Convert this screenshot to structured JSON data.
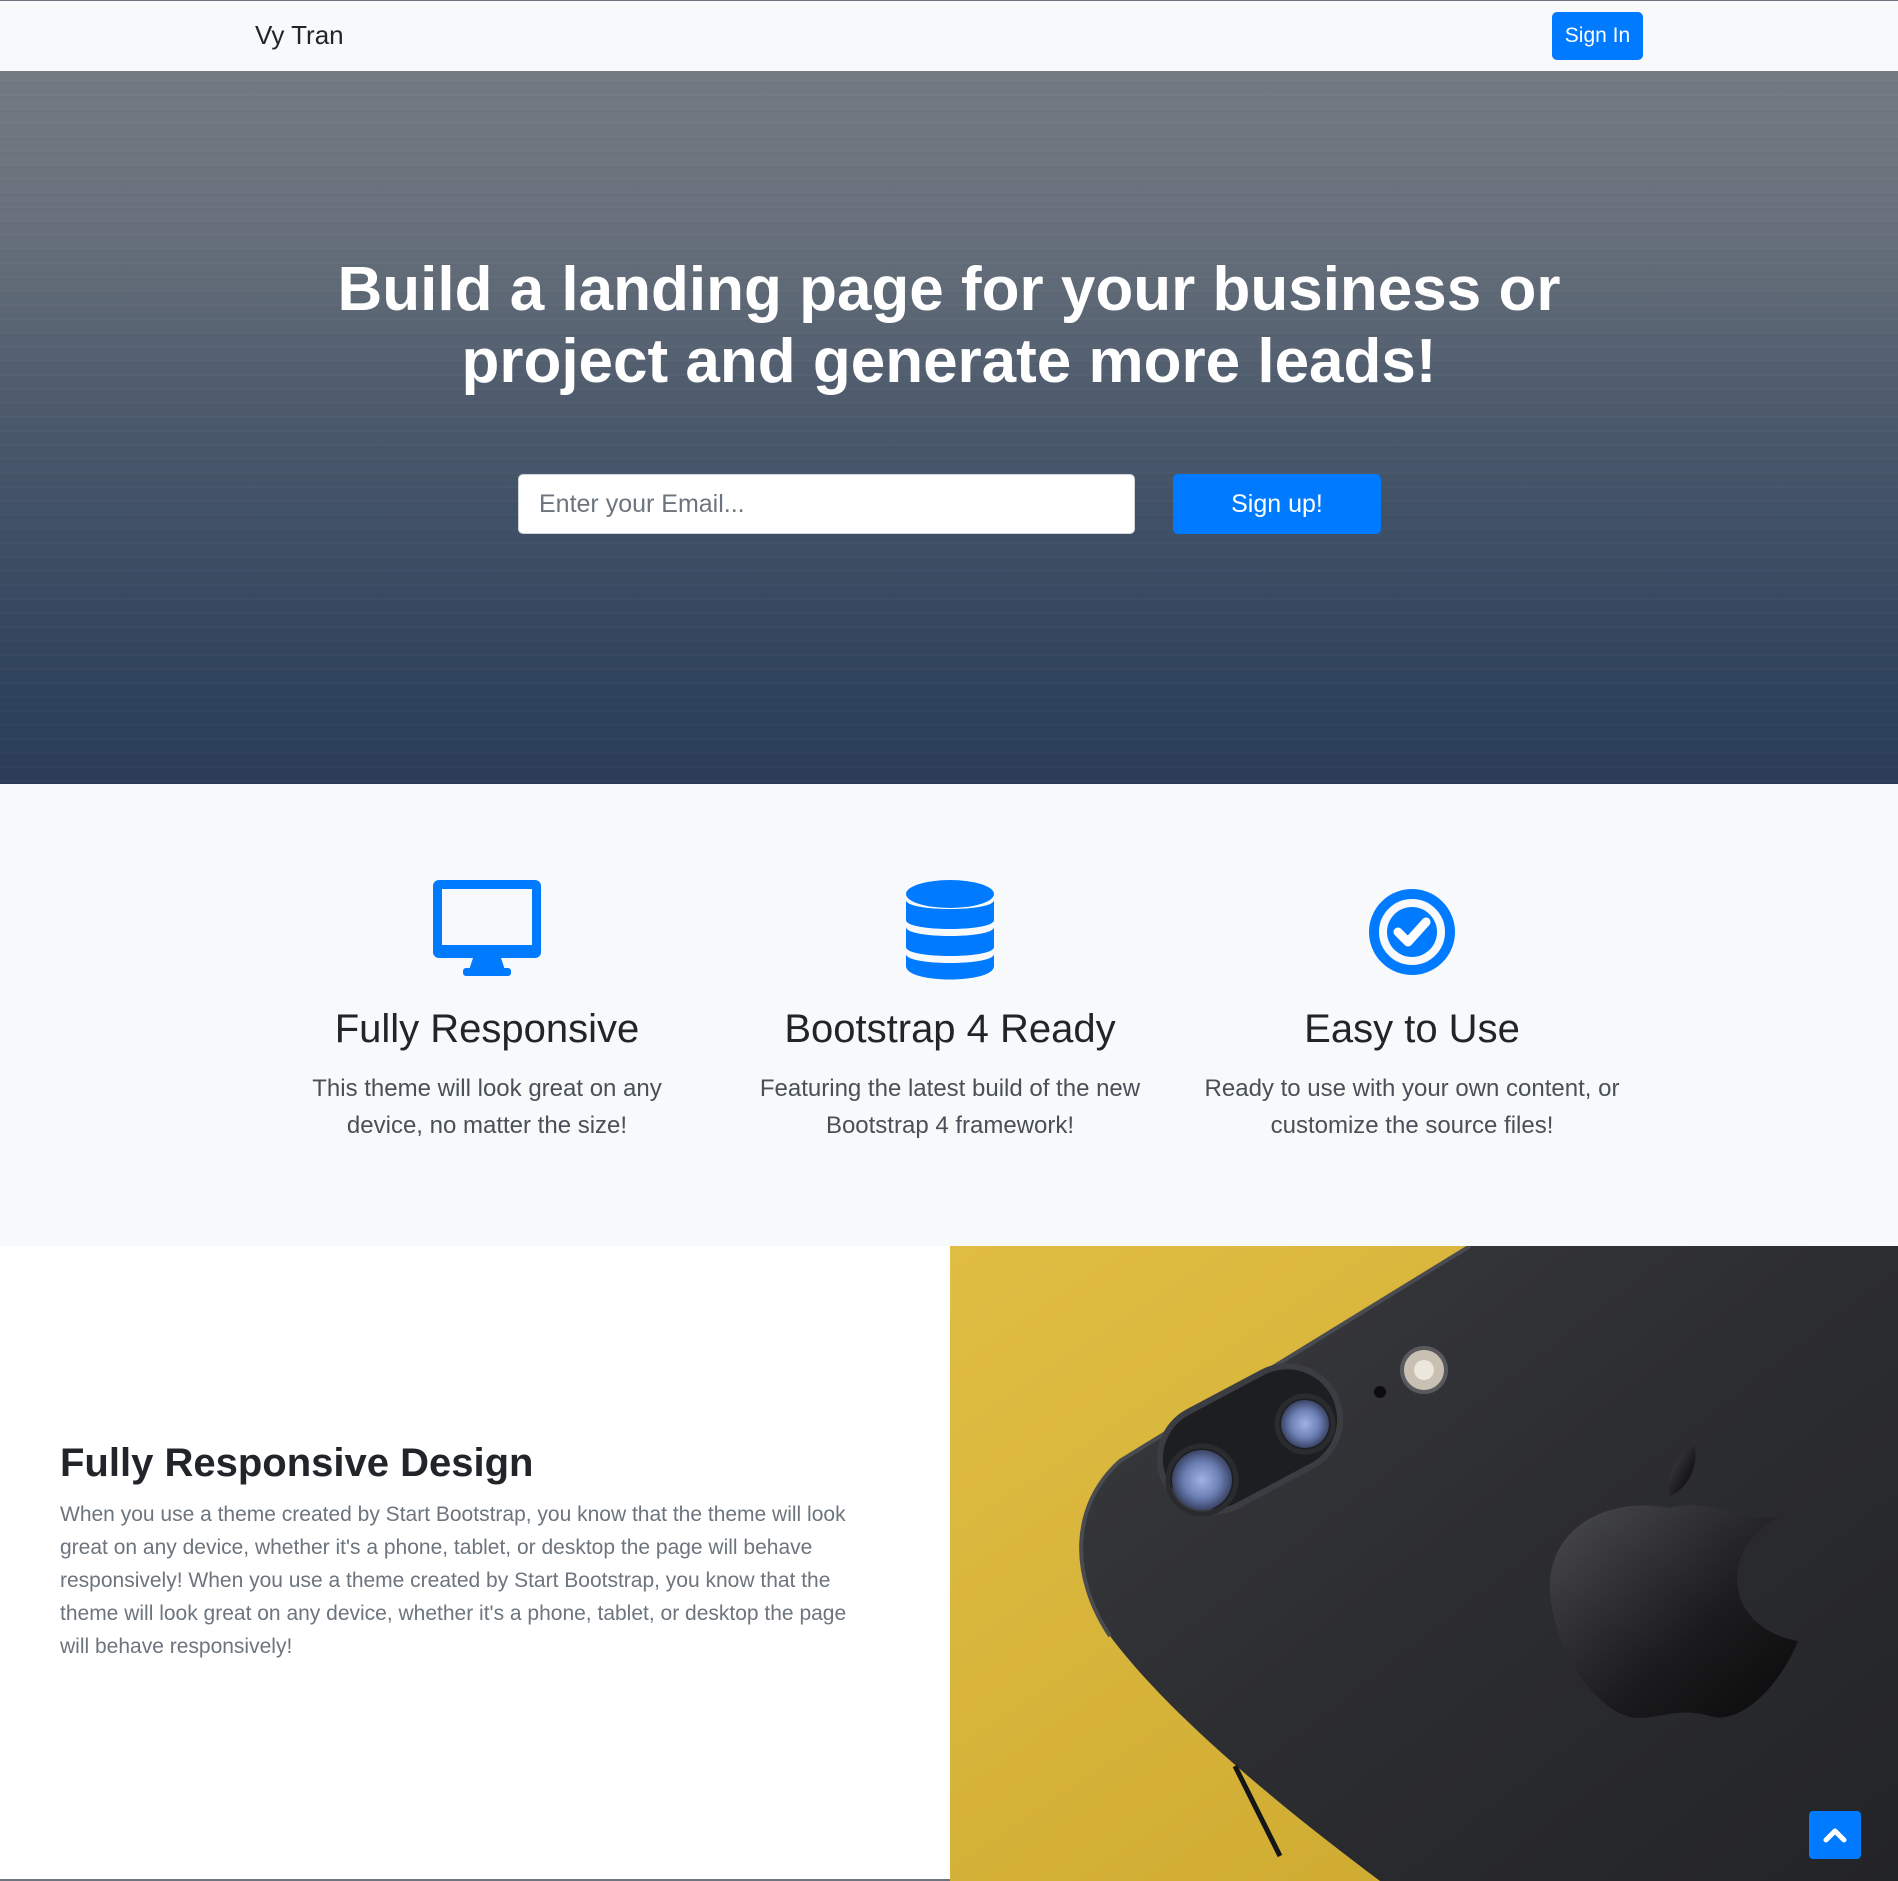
{
  "navbar": {
    "brand": "Vy Tran",
    "signin_label": "Sign In"
  },
  "masthead": {
    "heading": "Build a landing page for your business or project and generate more leads!",
    "email_placeholder": "Enter your Email...",
    "signup_label": "Sign up!"
  },
  "features": [
    {
      "icon": "desktop-icon",
      "title": "Fully Responsive",
      "text": "This theme will look great on any device, no matter the size!"
    },
    {
      "icon": "database-icon",
      "title": "Bootstrap 4 Ready",
      "text": "Featuring the latest build of the new Bootstrap 4 framework!"
    },
    {
      "icon": "check-circle-icon",
      "title": "Easy to Use",
      "text": "Ready to use with your own content, or customize the source files!"
    }
  ],
  "showcase": {
    "title": "Fully Responsive Design",
    "text": "When you use a theme created by Start Bootstrap, you know that the theme will look great on any device, whether it's a phone, tablet, or desktop the page will behave responsively! When you use a theme created by Start Bootstrap, you know that the theme will look great on any device, whether it's a phone, tablet, or desktop the page will behave responsively!",
    "image": "phone-photo"
  },
  "back_to_top": {
    "icon": "chevron-up-icon"
  },
  "colors": {
    "primary": "#007bff",
    "light_bg": "#f8f9fa",
    "text_dark": "#212529",
    "text_muted": "#6c757d"
  }
}
